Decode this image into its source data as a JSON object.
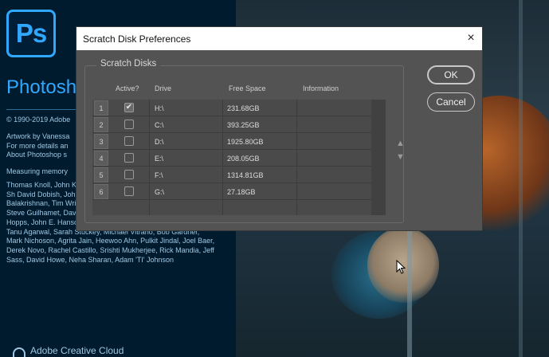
{
  "splash": {
    "app_name": "Photoshop",
    "logo_text": "Ps",
    "copyright": "© 1990-2019 Adobe",
    "artwork_lines": [
      "Artwork by Vanessa",
      "For more details an",
      "About Photoshop s"
    ],
    "measuring": "Measuring memory",
    "credits": "Thomas Knoll, John K Williams, Jackie Linco Jerry Harris, Mike Sh David Dobish, John P Severance, Yuko Ka Tai Luxon, Vinod Balakrishnan, Tim Wright, Maria Yap, Pam Clark, Kyoko Itoda, Steve Guilhamet, David Hackel, Eric Floch, Judy Lee, Kevin Hopps, John E. Hanson, Mark Dahm, James Mork, Min Plunkett, Tanu Agarwal, Sarah Stuckey, Michael Vitrano, Bob Gardner, Mark Nichoson, Agrita Jain, Heewoo Ahn, Pulkit Jindal, Joel Baer, Derek Novo, Rachel Castillo, Srishti Mukherjee, Rick Mandia, Jeff Sass, David Howe, Neha Sharan, Adam 'TI' Johnson",
    "footer": "Adobe Creative Cloud"
  },
  "dialog": {
    "title": "Scratch Disk Preferences",
    "close_icon": "×",
    "group_label": "Scratch Disks",
    "columns": {
      "active": "Active?",
      "drive": "Drive",
      "free_space": "Free Space",
      "information": "Information"
    },
    "rows": [
      {
        "num": "1",
        "active": true,
        "drive": "H:\\",
        "free": "231.68GB"
      },
      {
        "num": "2",
        "active": false,
        "drive": "C:\\",
        "free": "393.25GB"
      },
      {
        "num": "3",
        "active": false,
        "drive": "D:\\",
        "free": "1925.80GB"
      },
      {
        "num": "4",
        "active": false,
        "drive": "E:\\",
        "free": "208.05GB"
      },
      {
        "num": "5",
        "active": false,
        "drive": "F:\\",
        "free": "1314.81GB"
      },
      {
        "num": "6",
        "active": false,
        "drive": "G:\\",
        "free": "27.18GB"
      }
    ],
    "move_up_icon": "▲",
    "move_down_icon": "▼",
    "ok_label": "OK",
    "cancel_label": "Cancel"
  },
  "colors": {
    "ps_blue": "#31a8ff",
    "dialog_bg": "#535353"
  }
}
